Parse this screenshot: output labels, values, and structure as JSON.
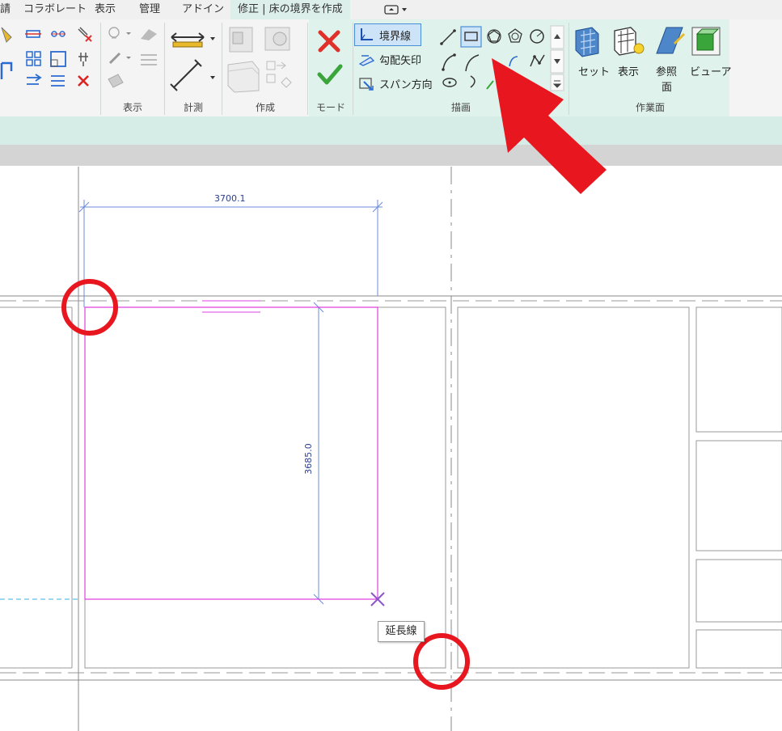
{
  "tabs": [
    {
      "label": "請"
    },
    {
      "label": "コラボレート"
    },
    {
      "label": "表示"
    },
    {
      "label": "管理"
    },
    {
      "label": "アドイン"
    },
    {
      "label": "修正 | 床の境界を作成"
    }
  ],
  "ribbon": {
    "panels": {
      "display": "表示",
      "measure": "計測",
      "create": "作成",
      "mode": "モード",
      "draw": "描画",
      "workplane": "作業面"
    },
    "draw_tools": {
      "boundary_line": "境界線",
      "slope_arrow": "勾配矢印",
      "span_direction": "スパン方向"
    },
    "workplane_tools": {
      "set": "セット",
      "show": "表示",
      "ref_plane_line1": "参照",
      "ref_plane_line2": "面",
      "viewer": "ビューア"
    }
  },
  "canvas": {
    "dim_horizontal": "3700.1",
    "dim_vertical": "3685.0",
    "tooltip": "延長線"
  },
  "colors": {
    "sketch_line": "#e040e0",
    "dimension": "#3a5fd0",
    "annotation_red": "#e8161e",
    "ribbon_context": "#dff2ec"
  }
}
